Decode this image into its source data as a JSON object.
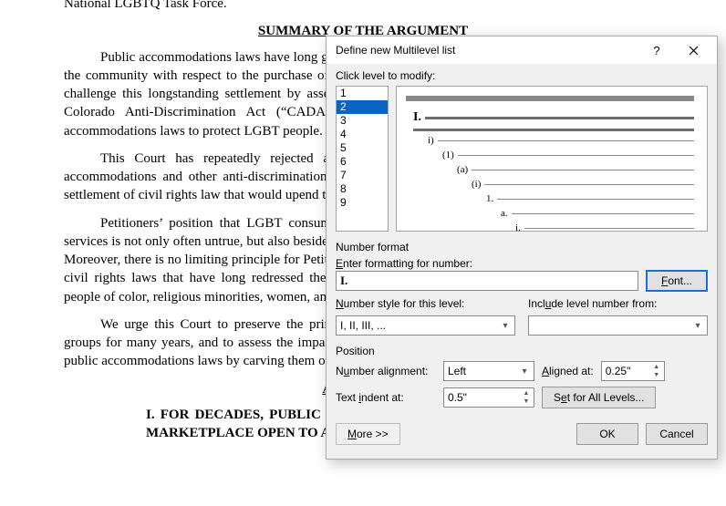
{
  "document": {
    "line0": "National LGBTQ Task Force.",
    "heading1": "SUMMARY OF THE ARGUMENT",
    "p1": "Public accommodations laws have long guaranteed that all people will be treated as equal members of the community with respect to the purchase of goods and services. 378 U.S. 226, 317 (1964). Petitioners challenge this longstanding settlement by asserting an unprecedented “free speech exemption” from the Colorado Anti-Discrimination Act (“CADA”). This does not just undermine the use of public accommodations laws to protect LGBT people. It undermines them for all.",
    "p2": "This Court has repeatedly rejected attempts to use the First Amendment to evade public accommodations and other anti-discrimination laws. Petitioners seek a departure from this longstanding settlement of civil rights law that would upend the operation of marketplaces.",
    "p3": "Petitioners’ position that LGBT consumers are not substantially harmed when denied goods and services is not only often untrue, but also beside the point given the purpose of public accommodations laws. Moreover, there is no limiting principle for Petitioners’ proposed exemption, which would equally jeopardize civil rights laws that have long redressed the harm experienced in the past—and sometimes today—by people of color, religious minorities, women, and others.",
    "p4": "We urge this Court to preserve the principles of equality and inclusion that have protected these groups for many years, and to assess the impact on civil rights should it undo the protections provided by public accommodations laws by carving them out through the First Amendment.",
    "heading2": "ARGUMENT",
    "h3": "I.    FOR  DECADES,  PUBLIC ACCOMMODATIONS LAWS HAVE MAINTAINED A MARKETPLACE OPEN TO ALL."
  },
  "dialog": {
    "title": "Define new Multilevel list",
    "help": "?",
    "labels": {
      "click_level": "Click level to modify:",
      "number_format": "Number format",
      "enter_formatting": "Enter formatting for number:",
      "font_btn": "Font...",
      "number_style": "Number style for this level:",
      "include_level": "Include level number from:",
      "position": "Position",
      "num_align": "Number alignment:",
      "aligned_at": "Aligned at:",
      "text_indent": "Text indent at:",
      "set_all": "Set for All Levels...",
      "more": "More >>",
      "ok": "OK",
      "cancel": "Cancel"
    },
    "levels": [
      "1",
      "2",
      "3",
      "4",
      "5",
      "6",
      "7",
      "8",
      "9"
    ],
    "selected_level": "2",
    "format_value": "I.",
    "number_style_value": "I, II, III, ...",
    "include_level_value": "",
    "num_align_value": "Left",
    "aligned_at_value": "0.25\"",
    "text_indent_value": "0.5\"",
    "preview": [
      "I.",
      "i)",
      "(1)",
      "(a)",
      "(i)",
      "1.",
      "a.",
      "i."
    ]
  }
}
